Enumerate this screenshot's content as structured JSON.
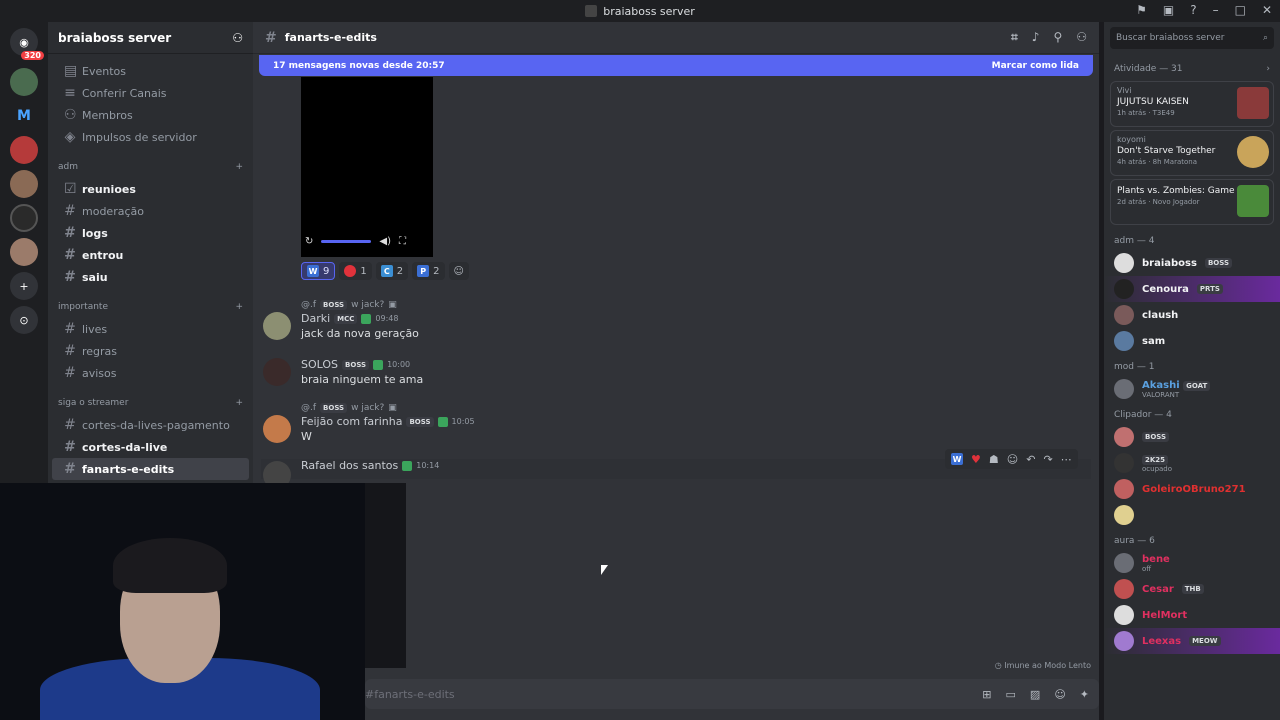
{
  "window": {
    "title": "braiaboss server"
  },
  "servers": {
    "home_badge": "320",
    "letters": [
      "M"
    ]
  },
  "server_header": {
    "name": "braiaboss server"
  },
  "sidebar": {
    "top_items": [
      {
        "label": "Eventos",
        "icon": "calendar-icon"
      },
      {
        "label": "Conferir Canais",
        "icon": "list-icon"
      },
      {
        "label": "Membros",
        "icon": "members-icon"
      },
      {
        "label": "Impulsos de servidor",
        "icon": "boost-icon"
      }
    ],
    "categories": [
      {
        "name": "adm",
        "channels": [
          {
            "label": "reunioes",
            "unread": true,
            "icon": "checkbox-icon"
          },
          {
            "label": "moderação",
            "unread": false
          },
          {
            "label": "logs",
            "unread": true
          },
          {
            "label": "entrou",
            "unread": true
          },
          {
            "label": "saiu",
            "unread": true
          }
        ]
      },
      {
        "name": "importante",
        "channels": [
          {
            "label": "lives",
            "unread": false
          },
          {
            "label": "regras",
            "unread": false
          },
          {
            "label": "avisos",
            "unread": false
          }
        ]
      },
      {
        "name": "siga o streamer",
        "channels": [
          {
            "label": "cortes-da-lives-pagamento",
            "unread": false
          },
          {
            "label": "cortes-da-live",
            "unread": true
          },
          {
            "label": "fanarts-e-edits",
            "unread": true,
            "active": true
          }
        ]
      }
    ]
  },
  "channel": {
    "name": "fanarts-e-edits"
  },
  "new_messages": {
    "text": "17 mensagens novas desde 20:57",
    "action": "Marcar como lida"
  },
  "reactions": [
    {
      "emoji": "W",
      "count": "9",
      "color": "#3b6fd4",
      "active": true
    },
    {
      "emoji": "●",
      "count": "1",
      "color": "#e0323b",
      "active": false
    },
    {
      "emoji": "C",
      "count": "2",
      "color": "#3b8fd4",
      "active": false
    },
    {
      "emoji": "P",
      "count": "2",
      "color": "#3b6fd4",
      "active": false
    }
  ],
  "messages": [
    {
      "reply_user": "@.f",
      "reply_tag": "BOSS",
      "reply_text": "w jack?",
      "user": "Darki",
      "tag": "MCC",
      "time": "09:48",
      "text": "jack da nova geração"
    },
    {
      "user": "SOLOS",
      "tag": "BOSS",
      "time": "10:00",
      "text": "braia ninguem te ama"
    },
    {
      "reply_user": "@.f",
      "reply_tag": "BOSS",
      "reply_text": "w jack?",
      "user": "Feijão com farinha",
      "tag": "BOSS",
      "time": "10:05",
      "text": "W"
    },
    {
      "user": "Rafael dos santos",
      "time": "10:14",
      "text": ""
    }
  ],
  "composer": {
    "placeholder": "#fanarts-e-edits",
    "slow_mode": "Imune ao Modo Lento"
  },
  "right_panel": {
    "search_placeholder": "Buscar braiaboss server",
    "activity_header": "Atividade — 31",
    "activities": [
      {
        "user": "Vivi",
        "game": "JUJUTSU KAISEN",
        "meta1": "1h atrás",
        "meta2": "T3E49"
      },
      {
        "user": "koyomi",
        "game": "Don't Starve Together",
        "meta1": "4h atrás",
        "meta2": "8h Maratona"
      },
      {
        "user": "",
        "game": "Plants vs. Zombies: Game ...",
        "meta1": "2d atrás",
        "meta2": "Novo Jogador"
      }
    ],
    "groups": [
      {
        "name": "adm — 4",
        "members": [
          {
            "name": "braiaboss",
            "tag": "BOSS"
          },
          {
            "name": "Cenoura",
            "tag": "PRTS",
            "highlight": true
          },
          {
            "name": "claush",
            "tag": ""
          },
          {
            "name": "sam",
            "tag": ""
          }
        ]
      },
      {
        "name": "mod — 1",
        "members": [
          {
            "name": "Akashi",
            "tag": "GOAT",
            "sub": "VALORANT"
          }
        ]
      },
      {
        "name": "Clipador — 4",
        "members": [
          {
            "name": "",
            "tag": "BOSS"
          },
          {
            "name": "",
            "tag": "2K25",
            "sub": "ocupado"
          },
          {
            "name": "GoleiroOBruno271",
            "tag": ""
          },
          {
            "name": "",
            "tag": ""
          }
        ]
      },
      {
        "name": "aura — 6",
        "members": [
          {
            "name": "bene",
            "tag": "",
            "sub": "off"
          },
          {
            "name": "Cesar",
            "tag": "THB"
          },
          {
            "name": "HelMort",
            "tag": ""
          },
          {
            "name": "Leexas",
            "tag": "MEOW"
          }
        ]
      }
    ]
  }
}
